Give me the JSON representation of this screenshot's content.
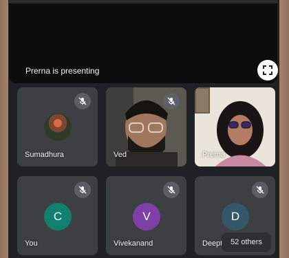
{
  "presentation": {
    "status_text": "Prerna is presenting",
    "fullscreen_icon": "fullscreen-icon"
  },
  "participants": [
    {
      "name": "Sumadhura",
      "type": "photo-avatar",
      "muted": true
    },
    {
      "name": "Ved",
      "type": "video",
      "muted": true
    },
    {
      "name": "Prerna",
      "type": "video",
      "muted": false
    },
    {
      "name": "You",
      "initial": "C",
      "avatar_color": "#12806f",
      "muted": true
    },
    {
      "name": "Vivekanand",
      "initial": "V",
      "avatar_color": "#7e3fa6",
      "muted": true
    },
    {
      "name": "Deept",
      "initial": "D",
      "avatar_color": "#35576a",
      "muted": true
    }
  ],
  "others": {
    "label": "52 others"
  },
  "colors": {
    "background": "#202124",
    "tile": "#3c4043"
  }
}
